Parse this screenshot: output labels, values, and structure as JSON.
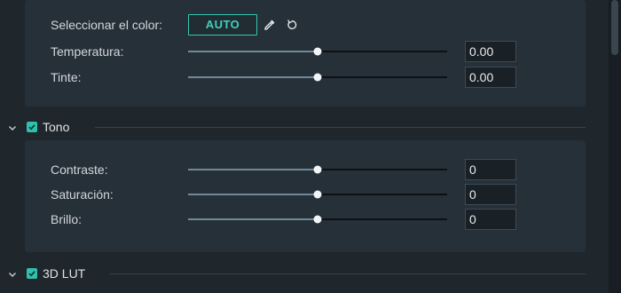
{
  "color_panel": {
    "select_color_label": "Seleccionar el color:",
    "auto_button": "AUTO",
    "eyedropper_icon": "eyedropper-icon",
    "reset_icon": "reset-icon",
    "sliders": [
      {
        "label": "Temperatura:",
        "value": "0.00",
        "level": 0.5
      },
      {
        "label": "Tinte:",
        "value": "0.00",
        "level": 0.5
      }
    ]
  },
  "tono": {
    "title": "Tono",
    "checked": true,
    "sliders": [
      {
        "label": "Contraste:",
        "value": "0",
        "level": 0.5
      },
      {
        "label": "Saturación:",
        "value": "0",
        "level": 0.5
      },
      {
        "label": "Brillo:",
        "value": "0",
        "level": 0.5
      }
    ]
  },
  "lut": {
    "title": "3D LUT",
    "checked": true
  },
  "colors": {
    "accent": "#35c6b3",
    "panel": "#263039",
    "background": "#1f262c"
  }
}
